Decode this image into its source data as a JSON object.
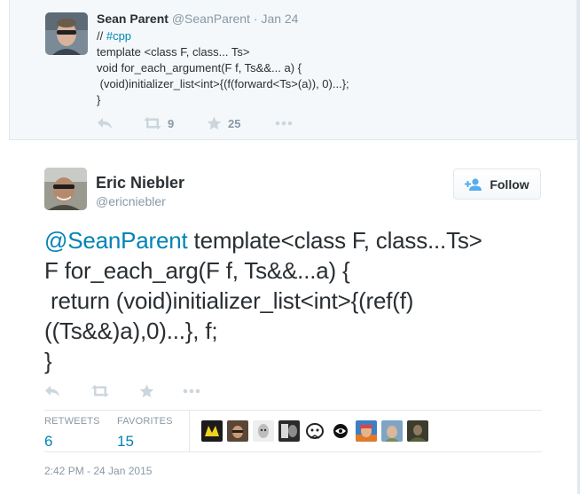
{
  "parent_tweet": {
    "name": "Sean Parent",
    "handle": "@SeanParent",
    "separator": "·",
    "date": "Jan 24",
    "line1_prefix": "// ",
    "line1_hashtag": "#cpp",
    "line2": "template <class F, class... Ts>",
    "line3": "void for_each_argument(F f, Ts&&... a) {",
    "line4": " (void)initializer_list<int>{(f(forward<Ts>(a)), 0)...};",
    "line5": "}",
    "retweet_count": "9",
    "favorite_count": "25",
    "icons": [
      "reply-icon",
      "retweet-icon",
      "star-icon",
      "more-icon"
    ]
  },
  "main_tweet": {
    "name": "Eric Niebler",
    "handle": "@ericniebler",
    "follow_label": "Follow",
    "mention": "@SeanParent",
    "line1_rest": " template<class F, class...Ts>",
    "line2": "F for_each_arg(F f, Ts&&...a) {",
    "line3": " return (void)initializer_list<int>{(ref(f)",
    "line4": "((Ts&&)a),0)...}, f;",
    "line5": "}",
    "stats": {
      "retweets_label": "RETWEETS",
      "retweets_value": "6",
      "favorites_label": "FAVORITES",
      "favorites_value": "15"
    },
    "favoriter_count_shown": 9,
    "timestamp": "2:42 PM - 24 Jan 2015",
    "colors": {
      "link": "#0084b4",
      "muted": "#8899a6",
      "text": "#292f33",
      "icon": "#ccd6dd",
      "border": "#e1e8ed",
      "parent_bg": "#f5f8fa"
    }
  }
}
